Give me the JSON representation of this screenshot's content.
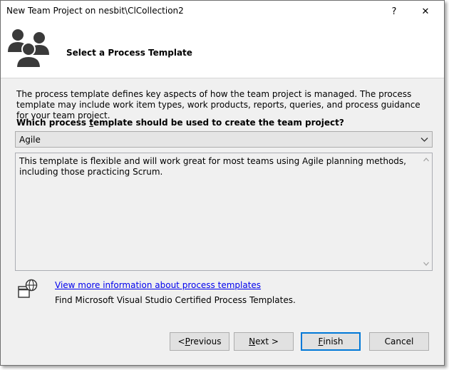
{
  "window": {
    "title": "New Team Project on nesbit\\ClCollection2",
    "help_glyph": "?",
    "close_glyph": "✕"
  },
  "header": {
    "title": "Select a Process Template",
    "icon": "team-project-icon"
  },
  "description": "The process template defines key aspects of how the team project is managed. The process template may include work item types, work products, reports, queries, and process guidance for your team project.",
  "question": {
    "before": "Which process ",
    "accel": "t",
    "after": "emplate should be used to create the team project?"
  },
  "template_select": {
    "selected": "Agile"
  },
  "template_description": "This template is flexible and will work great for most teams using Agile planning methods, including those practicing Scrum.",
  "more_info": {
    "icon": "globe-window-icon",
    "link": "View more information about process templates",
    "text": "Find Microsoft Visual Studio Certified Process Templates."
  },
  "buttons": {
    "previous": {
      "prefix": "< ",
      "accel": "P",
      "rest": "revious"
    },
    "next": {
      "prefix": "",
      "accel": "N",
      "rest": "ext >"
    },
    "finish": {
      "prefix": "",
      "accel": "F",
      "rest": "inish"
    },
    "cancel": {
      "label": "Cancel"
    }
  },
  "colors": {
    "link": "#0000ee",
    "default_button_border": "#0078d7",
    "dialog_background": "#f0f0f0"
  }
}
